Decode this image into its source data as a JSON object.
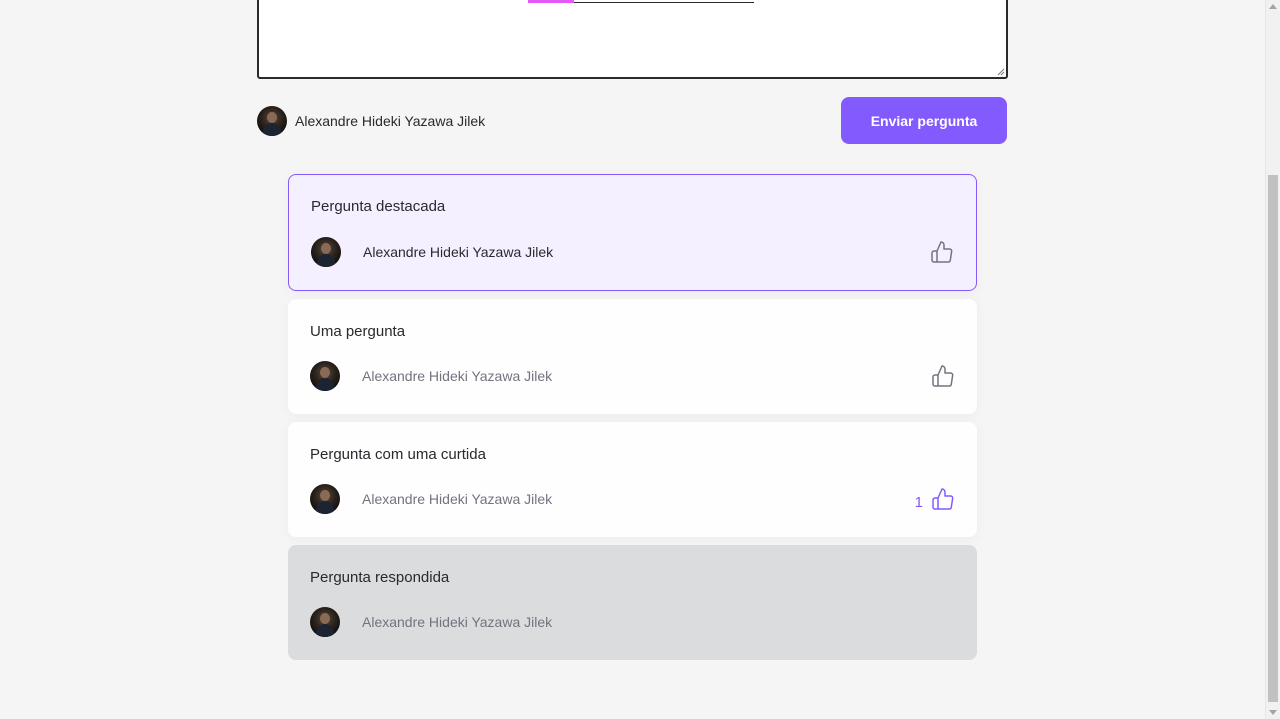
{
  "form": {
    "user_name": "Alexandre Hideki Yazawa Jilek",
    "send_label": "Enviar pergunta"
  },
  "questions": [
    {
      "content": "Pergunta destacada",
      "author": "Alexandre Hideki Yazawa Jilek",
      "state": "highlighted",
      "likes": ""
    },
    {
      "content": "Uma pergunta",
      "author": "Alexandre Hideki Yazawa Jilek",
      "state": "normal",
      "likes": ""
    },
    {
      "content": "Pergunta com uma curtida",
      "author": "Alexandre Hideki Yazawa Jilek",
      "state": "liked",
      "likes": "1"
    },
    {
      "content": "Pergunta respondida",
      "author": "Alexandre Hideki Yazawa Jilek",
      "state": "answered",
      "likes": ""
    }
  ],
  "colors": {
    "accent": "#835afd",
    "highlight_bg": "#f4f0ff",
    "answered_bg": "#dbdcdd",
    "text": "#29292e",
    "muted": "#737380"
  },
  "icons": {
    "like": "thumbs-up-icon"
  }
}
